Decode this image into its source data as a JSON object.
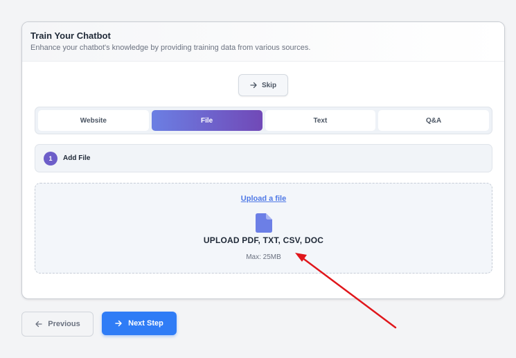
{
  "card": {
    "title": "Train Your Chatbot",
    "subtitle": "Enhance your chatbot's knowledge by providing training data from various sources."
  },
  "skip_label": "Skip",
  "tabs": [
    {
      "label": "Website",
      "active": false
    },
    {
      "label": "File",
      "active": true
    },
    {
      "label": "Text",
      "active": false
    },
    {
      "label": "Q&A",
      "active": false
    }
  ],
  "step": {
    "number": "1",
    "label": "Add File"
  },
  "upload": {
    "link": "Upload a file",
    "formats": "UPLOAD PDF, TXT, CSV, DOC",
    "max": "Max: 25MB"
  },
  "nav": {
    "previous": "Previous",
    "next": "Next Step"
  },
  "icons": {
    "skip": "arrow-right-icon",
    "file": "file-icon",
    "previous": "arrow-left-icon",
    "next": "arrow-right-icon"
  },
  "colors": {
    "accent_blue": "#2f7cf6",
    "tab_gradient_start": "#6b7fe3",
    "tab_gradient_end": "#7149b7",
    "file_icon": "#6c7fe6",
    "annotation_arrow": "#e0161b"
  }
}
